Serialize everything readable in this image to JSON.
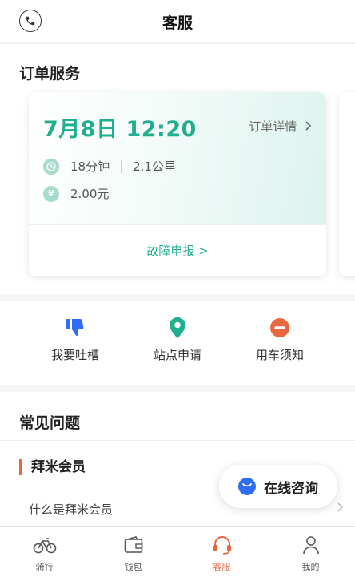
{
  "header": {
    "title": "客服",
    "left_icon": "phone-icon"
  },
  "order_service": {
    "title": "订单服务",
    "card": {
      "datetime": "7月8日 12:20",
      "detail_link": "订单详情",
      "duration": "18分钟",
      "distance": "2.1公里",
      "price": "2.00元",
      "report_link": "故障申报 >",
      "accent_color": "#1fae8e"
    }
  },
  "actions": [
    {
      "label": "我要吐槽",
      "icon": "thumbs-down-icon",
      "color": "#2f6df6"
    },
    {
      "label": "站点申请",
      "icon": "location-pin-icon",
      "color": "#1fae8e"
    },
    {
      "label": "用车须知",
      "icon": "minus-circle-icon",
      "color": "#e8673f"
    }
  ],
  "faq": {
    "title": "常见问题",
    "category": "拜米会员",
    "questions": [
      "什么是拜米会员"
    ]
  },
  "online_consult": {
    "label": "在线咨询",
    "icon": "chat-bubble-icon"
  },
  "tabbar": {
    "tabs": [
      {
        "label": "骑行",
        "icon": "bicycle-icon"
      },
      {
        "label": "钱包",
        "icon": "wallet-icon"
      },
      {
        "label": "客服",
        "icon": "headset-icon",
        "active": true
      },
      {
        "label": "我的",
        "icon": "person-icon"
      }
    ],
    "active_color": "#e8673f"
  }
}
